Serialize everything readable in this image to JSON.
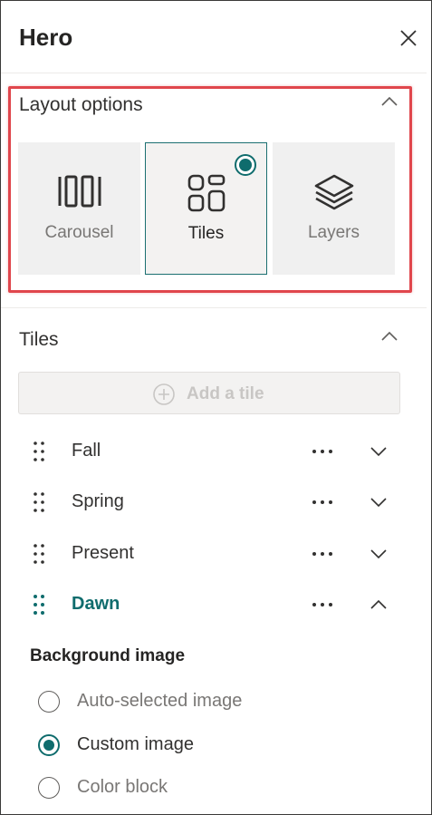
{
  "panel": {
    "title": "Hero",
    "close_icon": "close-icon"
  },
  "layout_options": {
    "heading": "Layout options",
    "options": [
      {
        "label": "Carousel",
        "icon": "carousel-icon",
        "selected": false
      },
      {
        "label": "Tiles",
        "icon": "tiles-icon",
        "selected": true
      },
      {
        "label": "Layers",
        "icon": "layers-icon",
        "selected": false
      }
    ]
  },
  "tiles": {
    "heading": "Tiles",
    "add_label": "Add a tile",
    "items": [
      {
        "name": "Fall",
        "expanded": false,
        "active": false
      },
      {
        "name": "Spring",
        "expanded": false,
        "active": false
      },
      {
        "name": "Present",
        "expanded": false,
        "active": false
      },
      {
        "name": "Dawn",
        "expanded": true,
        "active": true
      }
    ]
  },
  "background_image": {
    "heading": "Background image",
    "options": [
      {
        "label": "Auto-selected image",
        "checked": false
      },
      {
        "label": "Custom image",
        "checked": true
      },
      {
        "label": "Color block",
        "checked": false
      }
    ]
  },
  "colors": {
    "accent": "#0f6c6d",
    "highlight": "#e0464c"
  }
}
